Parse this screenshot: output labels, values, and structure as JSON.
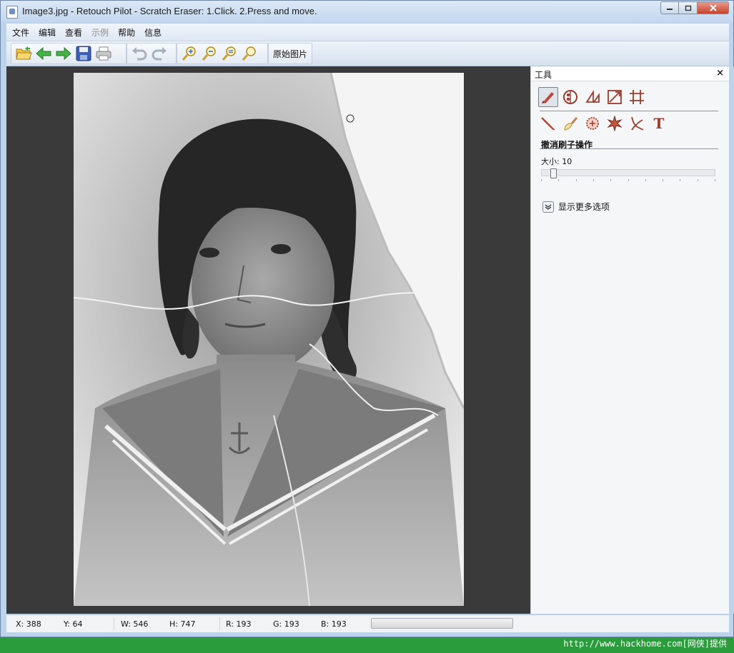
{
  "window": {
    "title": "Image3.jpg - Retouch Pilot - Scratch Eraser: 1.Click. 2.Press and move."
  },
  "menu": [
    {
      "label": "文件",
      "disabled": false
    },
    {
      "label": "编辑",
      "disabled": false
    },
    {
      "label": "查看",
      "disabled": false
    },
    {
      "label": "示例",
      "disabled": true
    },
    {
      "label": "帮助",
      "disabled": false
    },
    {
      "label": "信息",
      "disabled": false
    }
  ],
  "toolbar": {
    "icons": [
      "open-folder-icon",
      "back-arrow-icon",
      "forward-arrow-icon",
      "save-icon",
      "print-icon",
      "undo-icon",
      "redo-icon",
      "zoom-in-icon",
      "zoom-out-icon",
      "zoom-fit-icon",
      "zoom-actual-icon"
    ],
    "original_label": "原始图片"
  },
  "panel": {
    "title": "工具",
    "close_label": "×",
    "tools_row1": [
      "scratch-eraser-icon",
      "retouch-icon",
      "rotate-icon",
      "resize-icon",
      "crop-icon"
    ],
    "tools_row2": [
      "pencil-icon",
      "brush-icon",
      "pattern-icon",
      "star-icon",
      "smudge-icon",
      "text-icon"
    ],
    "text_tool_glyph": "T",
    "section_title": "撤消刷子操作",
    "size_label": "大小:",
    "size_value": "10",
    "size_level": 0.05,
    "more_options_label": "显示更多选项"
  },
  "status": {
    "x": "X: 388",
    "y": "Y: 64",
    "w": "W: 546",
    "h": "H: 747",
    "r": "R: 193",
    "g": "G: 193",
    "b": "B: 193"
  },
  "footer": {
    "credit": "http://www.hackhome.com[网侠]提供"
  },
  "colors": {
    "accent_green": "#2a9c3b",
    "canvas_bg": "#3a3a3a",
    "window_frame": "#bcd3ea",
    "tool_icon": "#9a3b2c"
  }
}
